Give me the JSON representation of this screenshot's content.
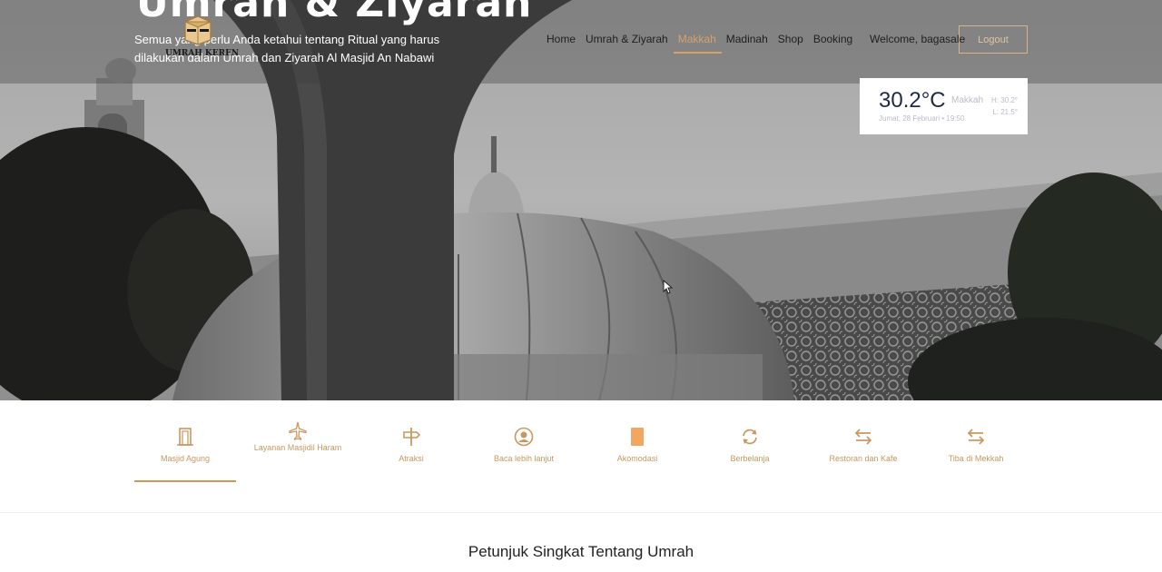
{
  "hero": {
    "title": "Umrah & Ziyarah",
    "subtitle": "Semua yang perlu Anda ketahui tentang Ritual yang harus dilakukan dalam Umrah dan Ziyarah Al Masjid An Nabawi"
  },
  "logo": {
    "text": "UMRAH KEREN"
  },
  "nav": {
    "items": [
      {
        "label": "Home"
      },
      {
        "label": "Umrah & Ziyarah"
      },
      {
        "label": "Makkah"
      },
      {
        "label": "Madinah"
      },
      {
        "label": "Shop"
      },
      {
        "label": "Booking"
      }
    ],
    "active_item": "Makkah"
  },
  "user": {
    "welcome": "Welcome, bagasale",
    "logout_label": "Logout"
  },
  "weather": {
    "temp": "30.2°C",
    "city": "Makkah",
    "date": "Jumat, 28 Februari • 19:50",
    "high": "H: 30.2°",
    "low": "L: 21.5°"
  },
  "tabs": {
    "items": [
      {
        "label": "Masjid Agung",
        "icon": "door-icon"
      },
      {
        "label": "Layanan Masjidil Haram",
        "icon": "airplane-icon"
      },
      {
        "label": "Atraksi",
        "icon": "signpost-icon"
      },
      {
        "label": "Baca lebih lanjut",
        "icon": "user-circle-icon"
      },
      {
        "label": "Akomodasi",
        "icon": "book-icon"
      },
      {
        "label": "Berbelanja",
        "icon": "refresh-icon"
      },
      {
        "label": "Restoran dan Kafe",
        "icon": "arrows-exchange-icon"
      },
      {
        "label": "Tiba di Mekkah",
        "icon": "arrows-exchange-icon"
      }
    ],
    "active_item": "Masjid Agung"
  },
  "section": {
    "title": "Petunjuk Singkat Tentang Umrah"
  },
  "colors": {
    "accent": "#c9975f",
    "nav_active": "#d4a26a",
    "weather_temp": "#1e2a44"
  }
}
